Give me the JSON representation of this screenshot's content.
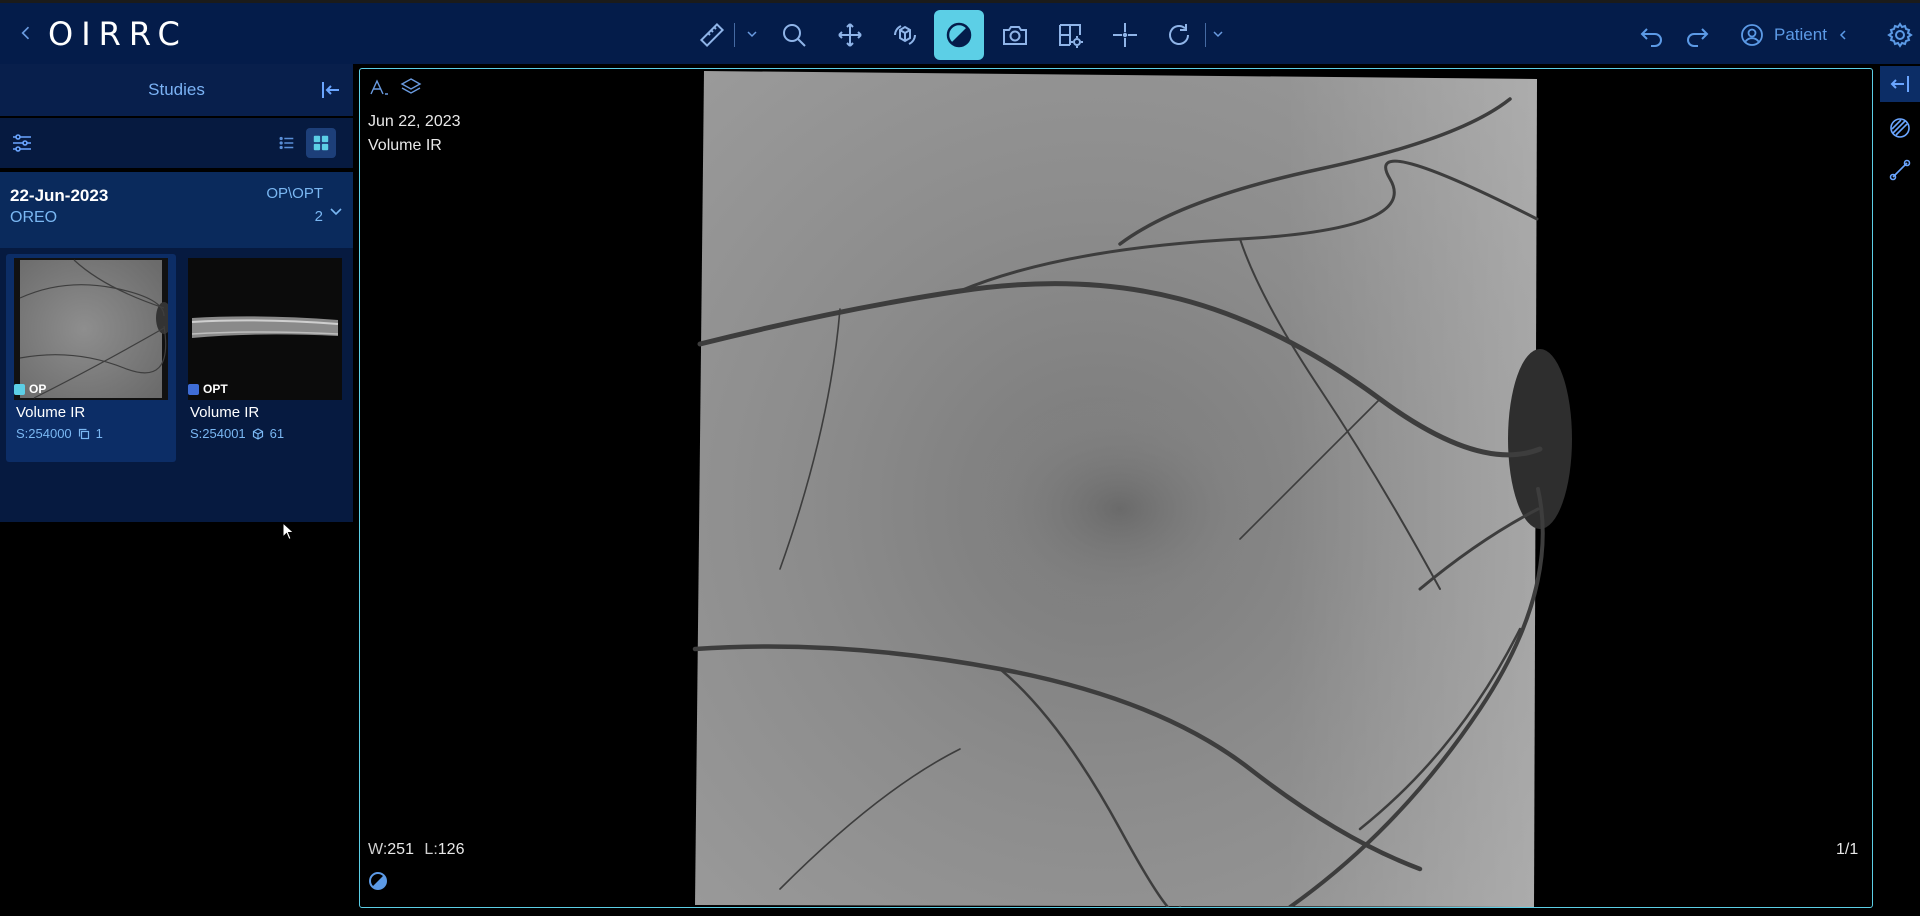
{
  "header": {
    "logo": "OIRRC",
    "patient_label": "Patient",
    "accent": "#5ccfe6",
    "background": "#041c4a",
    "tools": [
      "length-measure-icon",
      "zoom-icon",
      "pan-icon",
      "rotate-3d-icon",
      "window-level-icon",
      "capture-icon",
      "layout-settings-icon",
      "crosshairs-icon",
      "reset-rotate-icon"
    ]
  },
  "sidebar": {
    "title": "Studies",
    "study": {
      "date": "22-Jun-2023",
      "description": "OREO",
      "modalities": "OP\\OPT",
      "series_count": "2"
    },
    "series": [
      {
        "tag": "OP",
        "tag_color": "#5ccfe6",
        "title": "Volume IR",
        "number": "S:254000",
        "instances": "1"
      },
      {
        "tag": "OPT",
        "tag_color": "#3f6dd6",
        "title": "Volume IR",
        "number": "S:254001",
        "instances": "61"
      }
    ]
  },
  "viewer": {
    "date": "Jun 22, 2023",
    "description": "Volume IR",
    "window_label": "W:",
    "window_value": "251",
    "level_label": "L:",
    "level_value": "126",
    "frame": "1/1"
  }
}
